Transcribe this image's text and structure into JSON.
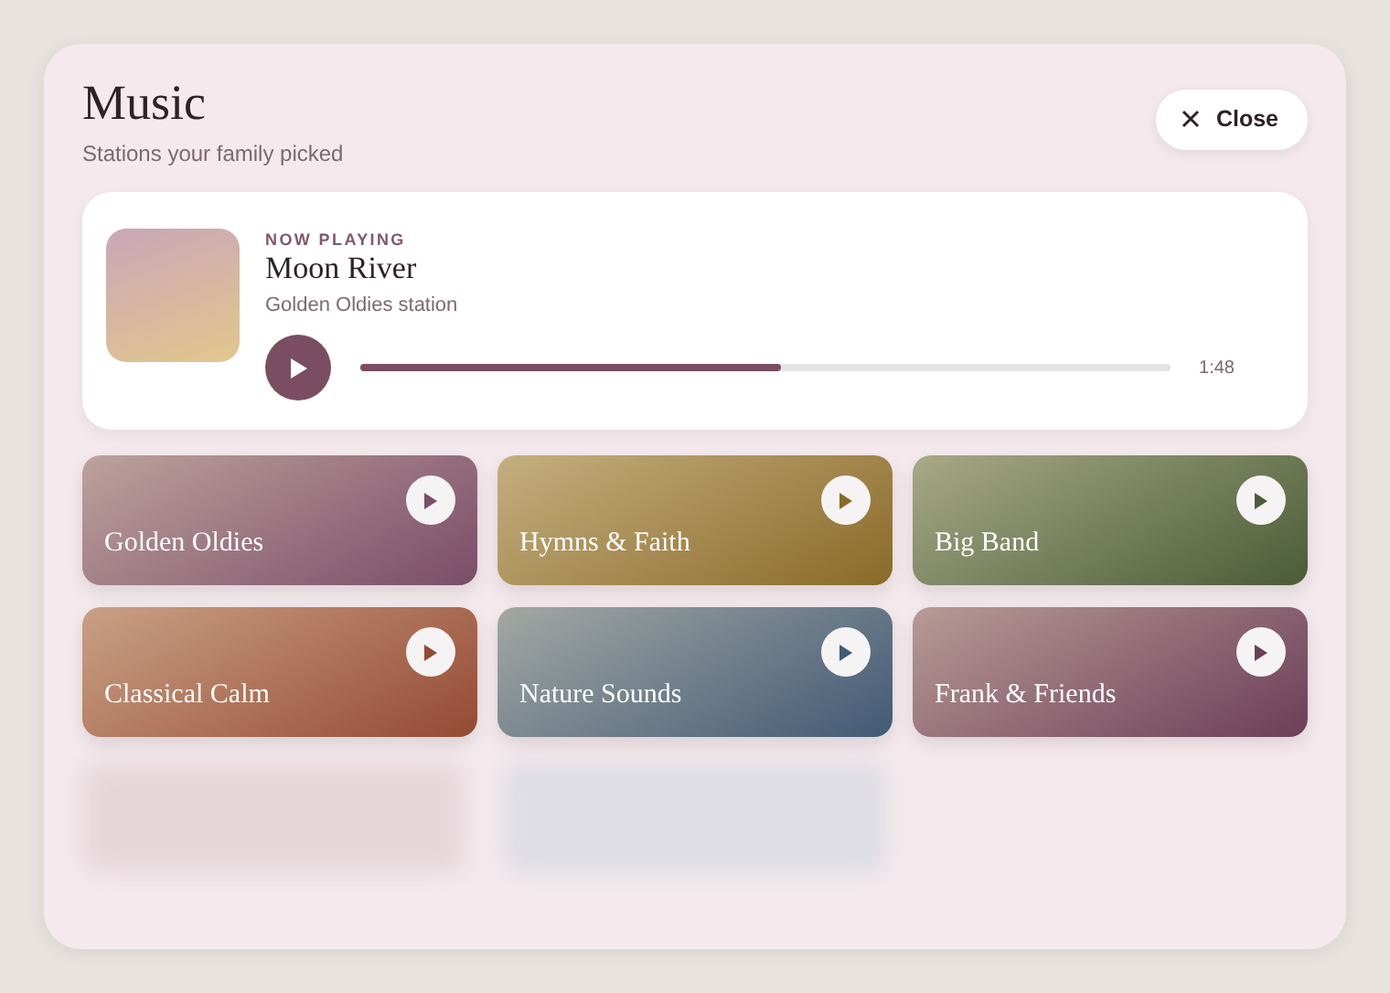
{
  "header": {
    "title": "Music",
    "subtitle": "Stations your family picked",
    "close_label": "Close"
  },
  "now_playing": {
    "eyebrow": "NOW PLAYING",
    "title": "Moon River",
    "station": "Golden Oldies station",
    "level": 0.52,
    "time": "1:48"
  },
  "stations": [
    {
      "name": "Golden Oldies",
      "color": "#7a4d68"
    },
    {
      "name": "Hymns & Faith",
      "color": "#8a6a26"
    },
    {
      "name": "Big Band",
      "color": "#4b5c38"
    },
    {
      "name": "Classical Calm",
      "color": "#944a34"
    },
    {
      "name": "Nature Sounds",
      "color": "#425a75"
    },
    {
      "name": "Frank & Friends",
      "color": "#6c3e58"
    }
  ]
}
